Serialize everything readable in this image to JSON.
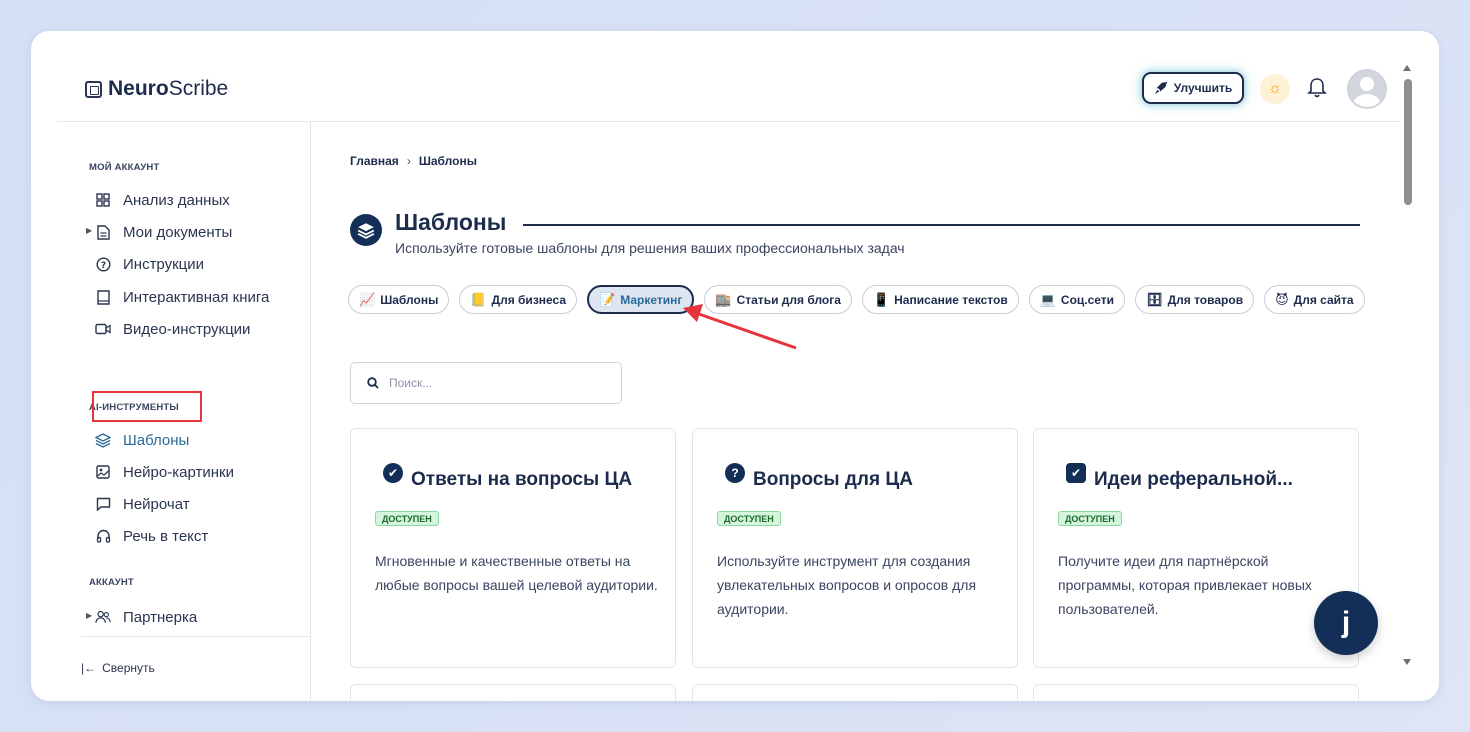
{
  "app": {
    "logo_bold": "Neuro",
    "logo_rest": "Scribe"
  },
  "header": {
    "upgrade_label": "Улучшить",
    "theme_icon": "sun-icon",
    "bell_icon": "bell-icon"
  },
  "sidebar": {
    "section_account": "МОЙ АККАУНТ",
    "items_account": [
      {
        "label": "Анализ данных",
        "icon": "grid-icon"
      },
      {
        "label": "Мои документы",
        "icon": "document-icon"
      },
      {
        "label": "Инструкции",
        "icon": "help-circle-icon"
      },
      {
        "label": "Интерактивная книга",
        "icon": "book-icon"
      },
      {
        "label": "Видео-инструкции",
        "icon": "video-icon"
      }
    ],
    "section_ai": "AI-ИНСТРУМЕНТЫ",
    "items_ai": [
      {
        "label": "Шаблоны",
        "icon": "layers-icon"
      },
      {
        "label": "Нейро-картинки",
        "icon": "image-icon"
      },
      {
        "label": "Нейрочат",
        "icon": "chat-icon"
      },
      {
        "label": "Речь в текст",
        "icon": "headphones-icon"
      }
    ],
    "section_user": "АККАУНТ",
    "items_user": [
      {
        "label": "Партнерка",
        "icon": "users-icon"
      }
    ],
    "collapse_label": "Свернуть"
  },
  "main": {
    "breadcrumb": {
      "home": "Главная",
      "current": "Шаблоны"
    },
    "title": "Шаблоны",
    "subtitle": "Используйте готовые шаблоны для решения ваших профессиональных задач",
    "chips": [
      {
        "emoji": "📈",
        "label": "Шаблоны"
      },
      {
        "emoji": "📒",
        "label": "Для бизнеса"
      },
      {
        "emoji": "📝",
        "label": "Маркетинг"
      },
      {
        "emoji": "🏬",
        "label": "Статьи для блога"
      },
      {
        "emoji": "📱",
        "label": "Написание текстов"
      },
      {
        "emoji": "💻",
        "label": "Соц.сети"
      },
      {
        "emoji": "🗄",
        "label": "Для товаров"
      },
      {
        "emoji": "😈",
        "label": "Для сайта"
      }
    ],
    "search_placeholder": "Поиск...",
    "cards": [
      {
        "title": "Ответы на вопросы ЦА",
        "badge": "ДОСТУПЕН",
        "desc": "Мгновенные и качественные ответы на любые вопросы вашей целевой аудитории.",
        "icon_glyph": "✔"
      },
      {
        "title": "Вопросы для ЦА",
        "badge": "ДОСТУПЕН",
        "desc": "Используйте инструмент для создания увлекательных вопросов и опросов для аудитории.",
        "icon_glyph": "?"
      },
      {
        "title": "Идеи реферальной...",
        "badge": "ДОСТУПЕН",
        "desc": "Получите идеи для партнёрской программы, которая привлекает новых пользователей.",
        "icon_glyph": "✔"
      }
    ],
    "fab_glyph": "ϳ"
  },
  "colors": {
    "accent": "#132f57",
    "highlight": "#e5343a",
    "badge_bg": "#d5f5dc"
  }
}
